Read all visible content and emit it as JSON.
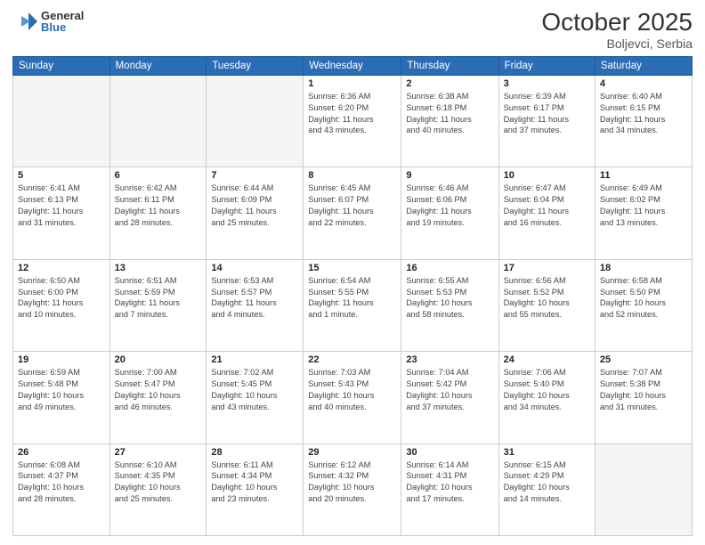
{
  "header": {
    "logo_general": "General",
    "logo_blue": "Blue",
    "title": "October 2025",
    "location": "Boljevci, Serbia"
  },
  "weekdays": [
    "Sunday",
    "Monday",
    "Tuesday",
    "Wednesday",
    "Thursday",
    "Friday",
    "Saturday"
  ],
  "weeks": [
    [
      {
        "day": "",
        "info": ""
      },
      {
        "day": "",
        "info": ""
      },
      {
        "day": "",
        "info": ""
      },
      {
        "day": "1",
        "info": "Sunrise: 6:36 AM\nSunset: 6:20 PM\nDaylight: 11 hours\nand 43 minutes."
      },
      {
        "day": "2",
        "info": "Sunrise: 6:38 AM\nSunset: 6:18 PM\nDaylight: 11 hours\nand 40 minutes."
      },
      {
        "day": "3",
        "info": "Sunrise: 6:39 AM\nSunset: 6:17 PM\nDaylight: 11 hours\nand 37 minutes."
      },
      {
        "day": "4",
        "info": "Sunrise: 6:40 AM\nSunset: 6:15 PM\nDaylight: 11 hours\nand 34 minutes."
      }
    ],
    [
      {
        "day": "5",
        "info": "Sunrise: 6:41 AM\nSunset: 6:13 PM\nDaylight: 11 hours\nand 31 minutes."
      },
      {
        "day": "6",
        "info": "Sunrise: 6:42 AM\nSunset: 6:11 PM\nDaylight: 11 hours\nand 28 minutes."
      },
      {
        "day": "7",
        "info": "Sunrise: 6:44 AM\nSunset: 6:09 PM\nDaylight: 11 hours\nand 25 minutes."
      },
      {
        "day": "8",
        "info": "Sunrise: 6:45 AM\nSunset: 6:07 PM\nDaylight: 11 hours\nand 22 minutes."
      },
      {
        "day": "9",
        "info": "Sunrise: 6:46 AM\nSunset: 6:06 PM\nDaylight: 11 hours\nand 19 minutes."
      },
      {
        "day": "10",
        "info": "Sunrise: 6:47 AM\nSunset: 6:04 PM\nDaylight: 11 hours\nand 16 minutes."
      },
      {
        "day": "11",
        "info": "Sunrise: 6:49 AM\nSunset: 6:02 PM\nDaylight: 11 hours\nand 13 minutes."
      }
    ],
    [
      {
        "day": "12",
        "info": "Sunrise: 6:50 AM\nSunset: 6:00 PM\nDaylight: 11 hours\nand 10 minutes."
      },
      {
        "day": "13",
        "info": "Sunrise: 6:51 AM\nSunset: 5:59 PM\nDaylight: 11 hours\nand 7 minutes."
      },
      {
        "day": "14",
        "info": "Sunrise: 6:53 AM\nSunset: 5:57 PM\nDaylight: 11 hours\nand 4 minutes."
      },
      {
        "day": "15",
        "info": "Sunrise: 6:54 AM\nSunset: 5:55 PM\nDaylight: 11 hours\nand 1 minute."
      },
      {
        "day": "16",
        "info": "Sunrise: 6:55 AM\nSunset: 5:53 PM\nDaylight: 10 hours\nand 58 minutes."
      },
      {
        "day": "17",
        "info": "Sunrise: 6:56 AM\nSunset: 5:52 PM\nDaylight: 10 hours\nand 55 minutes."
      },
      {
        "day": "18",
        "info": "Sunrise: 6:58 AM\nSunset: 5:50 PM\nDaylight: 10 hours\nand 52 minutes."
      }
    ],
    [
      {
        "day": "19",
        "info": "Sunrise: 6:59 AM\nSunset: 5:48 PM\nDaylight: 10 hours\nand 49 minutes."
      },
      {
        "day": "20",
        "info": "Sunrise: 7:00 AM\nSunset: 5:47 PM\nDaylight: 10 hours\nand 46 minutes."
      },
      {
        "day": "21",
        "info": "Sunrise: 7:02 AM\nSunset: 5:45 PM\nDaylight: 10 hours\nand 43 minutes."
      },
      {
        "day": "22",
        "info": "Sunrise: 7:03 AM\nSunset: 5:43 PM\nDaylight: 10 hours\nand 40 minutes."
      },
      {
        "day": "23",
        "info": "Sunrise: 7:04 AM\nSunset: 5:42 PM\nDaylight: 10 hours\nand 37 minutes."
      },
      {
        "day": "24",
        "info": "Sunrise: 7:06 AM\nSunset: 5:40 PM\nDaylight: 10 hours\nand 34 minutes."
      },
      {
        "day": "25",
        "info": "Sunrise: 7:07 AM\nSunset: 5:38 PM\nDaylight: 10 hours\nand 31 minutes."
      }
    ],
    [
      {
        "day": "26",
        "info": "Sunrise: 6:08 AM\nSunset: 4:37 PM\nDaylight: 10 hours\nand 28 minutes."
      },
      {
        "day": "27",
        "info": "Sunrise: 6:10 AM\nSunset: 4:35 PM\nDaylight: 10 hours\nand 25 minutes."
      },
      {
        "day": "28",
        "info": "Sunrise: 6:11 AM\nSunset: 4:34 PM\nDaylight: 10 hours\nand 23 minutes."
      },
      {
        "day": "29",
        "info": "Sunrise: 6:12 AM\nSunset: 4:32 PM\nDaylight: 10 hours\nand 20 minutes."
      },
      {
        "day": "30",
        "info": "Sunrise: 6:14 AM\nSunset: 4:31 PM\nDaylight: 10 hours\nand 17 minutes."
      },
      {
        "day": "31",
        "info": "Sunrise: 6:15 AM\nSunset: 4:29 PM\nDaylight: 10 hours\nand 14 minutes."
      },
      {
        "day": "",
        "info": ""
      }
    ]
  ]
}
